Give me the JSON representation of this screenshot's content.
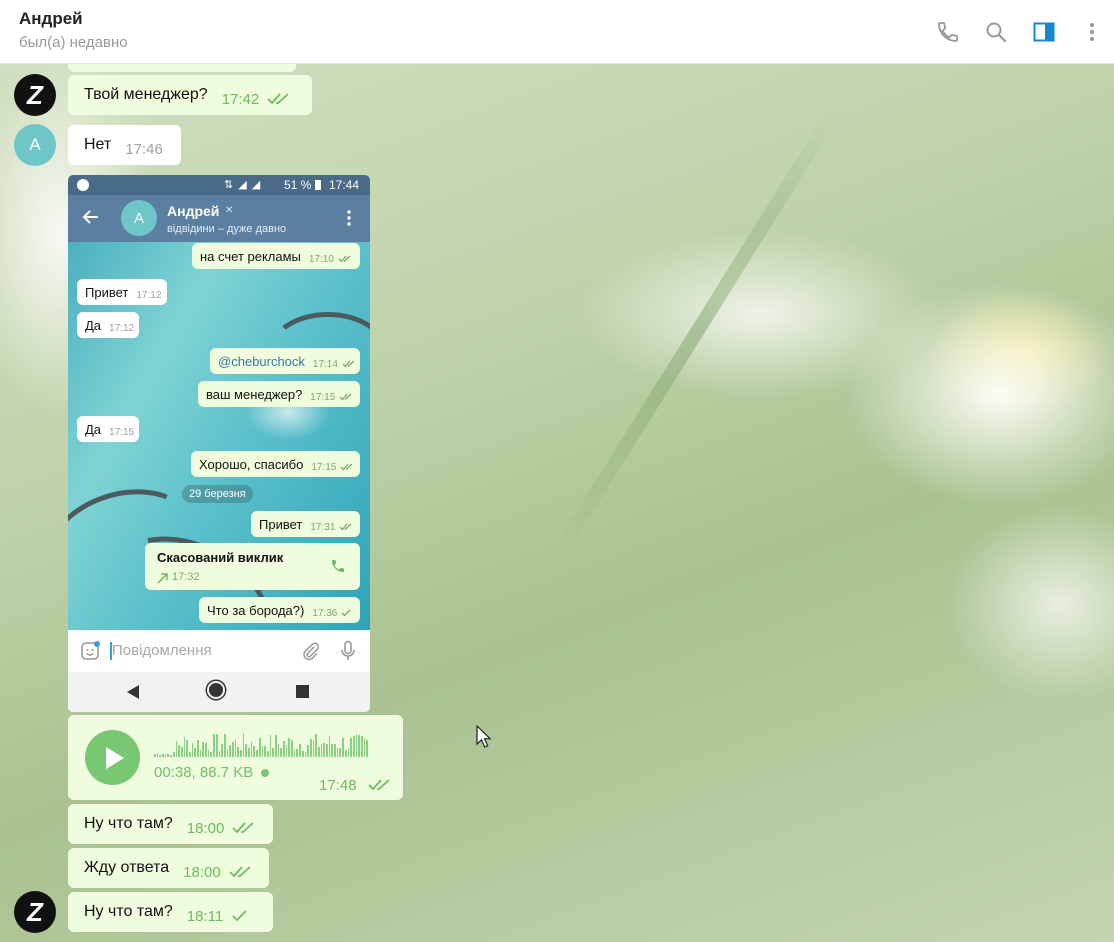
{
  "header": {
    "contact_name": "Андрей",
    "contact_status": "был(а) недавно",
    "icons": [
      "phone-icon",
      "search-icon",
      "sidebar-toggle-icon",
      "more-vertical-icon"
    ],
    "accent": "#168acd"
  },
  "messages": {
    "m1": {
      "text": "Твой менеджер?",
      "time": "17:42"
    },
    "m2": {
      "text": "Нет",
      "time": "17:46",
      "avatar_letter": "A"
    },
    "voice": {
      "meta": "00:38, 88.7 KB",
      "time": "17:48"
    },
    "m3": {
      "text": "Ну что там?",
      "time": "18:00"
    },
    "m4": {
      "text": "Жду ответа",
      "time": "18:00"
    },
    "m5": {
      "text": "Ну что там?",
      "time": "18:11"
    },
    "avatar_self_letter": "Z"
  },
  "phone": {
    "statusbar": {
      "battery": "51 %",
      "time": "17:44"
    },
    "header": {
      "avatar_letter": "A",
      "name": "Андрей",
      "status": "відвідини – дуже давно"
    },
    "bubbles": [
      {
        "text": "на счет рекламы",
        "time": "17:10"
      },
      {
        "text": "Привет",
        "time": "17:12"
      },
      {
        "text": "Да",
        "time": "17:12"
      },
      {
        "text": "@cheburchock",
        "time": "17:14"
      },
      {
        "text": "ваш менеджер?",
        "time": "17:15"
      },
      {
        "text": "Да",
        "time": "17:15"
      },
      {
        "text": "Хорошо, спасибо",
        "time": "17:15"
      },
      {
        "text": "Привет",
        "time": "17:31"
      },
      {
        "text": "Что за борода?)",
        "time": "17:36"
      }
    ],
    "date_divider": "29 березня",
    "call": {
      "title": "Скасований виклик",
      "time": "17:32"
    },
    "input_placeholder": "Повідомлення"
  },
  "colors": {
    "outgoing_bubble": "#effdde",
    "incoming_bubble": "#ffffff",
    "tick_green": "#6dbb60",
    "voice_green": "#78c772"
  }
}
